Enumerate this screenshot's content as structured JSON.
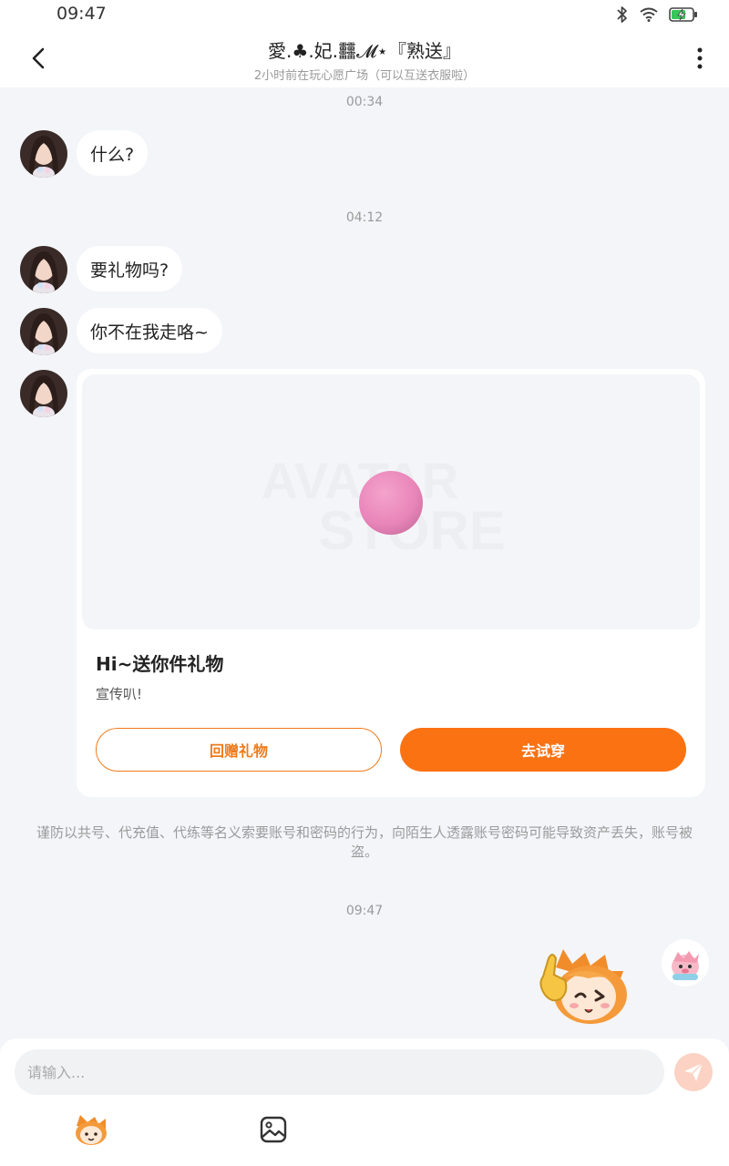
{
  "status_bar": {
    "time": "09:47"
  },
  "header": {
    "title": "愛.♣.妃.䨻𝓜⋆『熟送』",
    "subtitle": "2小时前在玩心愿广场（可以互送衣服啦）"
  },
  "messages": [
    {
      "timestamp": "00:34",
      "text": "什么?"
    },
    {
      "timestamp": "04:12",
      "text": "要礼物吗?"
    },
    {
      "text": "你不在我走咯~"
    }
  ],
  "gift_card": {
    "watermark_line1": "AVATAR",
    "watermark_line2": "STORE",
    "title": "Hi~送你件礼物",
    "description": "宣传叭!",
    "return_button": "回赠礼物",
    "try_button": "去试穿"
  },
  "warning": "谨防以共号、代充值、代练等名义索要账号和密码的行为，向陌生人透露账号密码可能导致资产丢失，账号被盗。",
  "last_timestamp": "09:47",
  "composer": {
    "placeholder": "请输入..."
  },
  "colors": {
    "accent": "#fb7213",
    "send_disabled": "#fbd2c3",
    "background": "#f3f5f8"
  },
  "icons": [
    "bluetooth-icon",
    "wifi-icon",
    "battery-icon",
    "back-arrow-icon",
    "more-icon",
    "send-icon",
    "emoji-icon",
    "image-icon"
  ]
}
